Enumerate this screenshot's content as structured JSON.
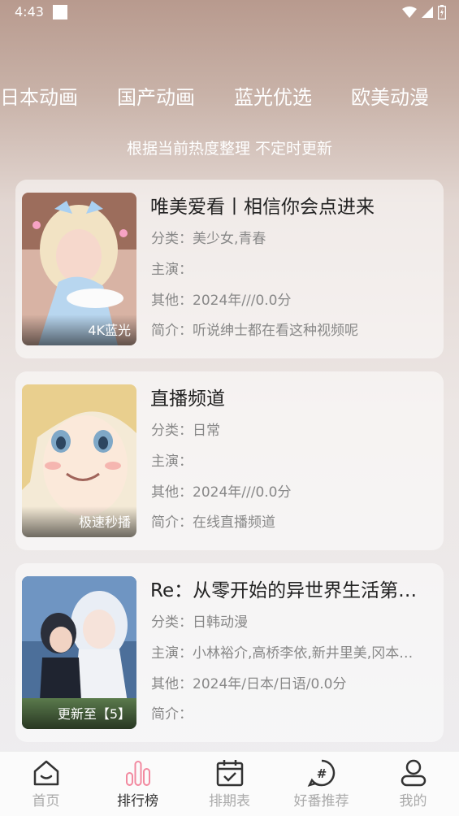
{
  "status": {
    "time": "4:43"
  },
  "category_tabs": [
    "日本动画",
    "国产动画",
    "蓝光优选",
    "欧美动漫"
  ],
  "subtitle": "根据当前热度整理 不定时更新",
  "cards": [
    {
      "title": "唯美爱看丨相信你会点进来",
      "badge": "4K蓝光",
      "category": "分类：美少女,青春",
      "cast": "主演：",
      "other": "其他：2024年///0.0分",
      "intro": "简介：听说绅士都在看这种视频呢"
    },
    {
      "title": "直播频道",
      "badge": "极速秒播",
      "category": "分类：日常",
      "cast": "主演：",
      "other": "其他：2024年///0.0分",
      "intro": "简介：在线直播频道"
    },
    {
      "title": "Re：从零开始的异世界生活第…",
      "badge": "更新至【5】",
      "category": "分类：日韩动漫",
      "cast": "主演：小林裕介,高桥李依,新井里美,冈本…",
      "other": "其他：2024年/日本/日语/0.0分",
      "intro": "简介："
    }
  ],
  "bottom_nav": [
    {
      "label": "首页",
      "icon": "home-icon"
    },
    {
      "label": "排行榜",
      "icon": "ranking-icon",
      "active": true
    },
    {
      "label": "排期表",
      "icon": "schedule-icon"
    },
    {
      "label": "好番推荐",
      "icon": "hashtag-icon"
    },
    {
      "label": "我的",
      "icon": "user-icon"
    }
  ],
  "colors": {
    "accent": "#f28aa0",
    "nav_inactive": "#aaaaaa",
    "nav_active": "#333333"
  }
}
